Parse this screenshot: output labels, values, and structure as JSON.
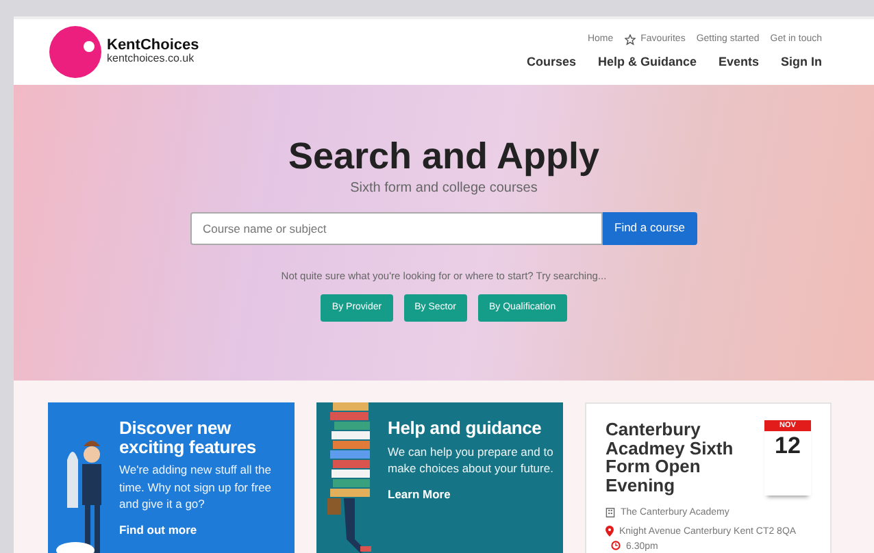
{
  "header": {
    "logo": {
      "name": "KentChoices",
      "domain": "kentchoices.co.uk"
    },
    "top_links": [
      {
        "label": "Home",
        "kind": "link"
      },
      {
        "label": "Favourites",
        "kind": "favourite"
      },
      {
        "label": "Getting started",
        "kind": "link"
      },
      {
        "label": "Get in touch",
        "kind": "link"
      }
    ],
    "main_nav": [
      "Courses",
      "Help & Guidance",
      "Events",
      "Sign In"
    ]
  },
  "hero": {
    "title": "Search and Apply",
    "subtitle": "Sixth form and college courses",
    "search": {
      "placeholder": "Course name or subject",
      "button": "Find a course"
    },
    "hint": "Not quite sure what you're looking for or where to start? Try searching...",
    "filters": [
      "By Provider",
      "By Sector",
      "By Qualification"
    ]
  },
  "cards": [
    {
      "kind": "promo",
      "title": "Discover new exciting features",
      "text": "We're adding new stuff all the time. Why not sign up for free and give it a go?",
      "link": "Find out more",
      "color": "#1f7bd8"
    },
    {
      "kind": "promo",
      "title": "Help and guidance",
      "text": "We can help you prepare and to make choices about your future.",
      "link": "Learn More",
      "color": "#157486"
    },
    {
      "kind": "event",
      "title": "Canterbury Acadmey Sixth Form Open Evening",
      "month": "NOV",
      "day": "12",
      "provider": "The Canterbury Academy",
      "address": "Knight Avenue Canterbury Kent CT2 8QA",
      "time": "6.30pm"
    }
  ]
}
